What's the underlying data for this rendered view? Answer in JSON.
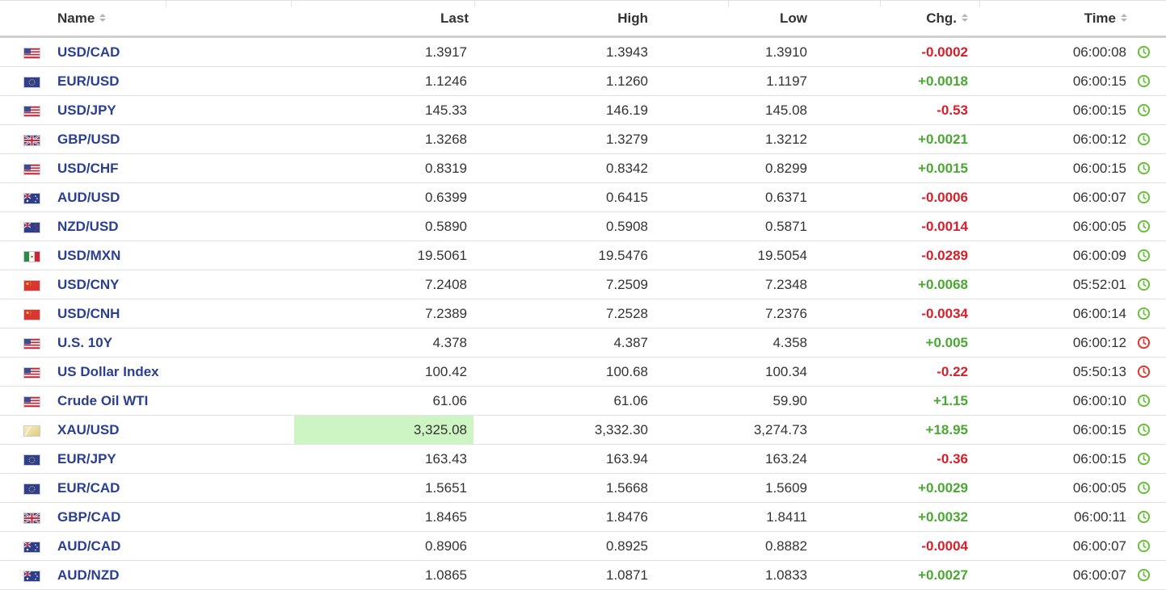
{
  "header": {
    "name_label": "Name",
    "last_label": "Last",
    "high_label": "High",
    "low_label": "Low",
    "chg_label": "Chg.",
    "time_label": "Time"
  },
  "colors": {
    "link": "#2a3f90",
    "positive": "#4aa832",
    "negative": "#d3202a",
    "highlight": "#cdf5c4",
    "clock_green": "#6abf3a",
    "clock_red": "#e5342d"
  },
  "rows": [
    {
      "name": "USD/CAD",
      "flag": "us-flag-icon",
      "last": "1.3917",
      "high": "1.3943",
      "low": "1.3910",
      "chg": "-0.0002",
      "time": "06:00:08",
      "status": "green-clock-icon"
    },
    {
      "name": "EUR/USD",
      "flag": "eu-flag-icon",
      "last": "1.1246",
      "high": "1.1260",
      "low": "1.1197",
      "chg": "+0.0018",
      "time": "06:00:15",
      "status": "green-clock-icon"
    },
    {
      "name": "USD/JPY",
      "flag": "us-flag-icon",
      "last": "145.33",
      "high": "146.19",
      "low": "145.08",
      "chg": "-0.53",
      "time": "06:00:15",
      "status": "green-clock-icon"
    },
    {
      "name": "GBP/USD",
      "flag": "uk-flag-icon",
      "last": "1.3268",
      "high": "1.3279",
      "low": "1.3212",
      "chg": "+0.0021",
      "time": "06:00:12",
      "status": "green-clock-icon"
    },
    {
      "name": "USD/CHF",
      "flag": "us-flag-icon",
      "last": "0.8319",
      "high": "0.8342",
      "low": "0.8299",
      "chg": "+0.0015",
      "time": "06:00:15",
      "status": "green-clock-icon"
    },
    {
      "name": "AUD/USD",
      "flag": "au-flag-icon",
      "last": "0.6399",
      "high": "0.6415",
      "low": "0.6371",
      "chg": "-0.0006",
      "time": "06:00:07",
      "status": "green-clock-icon"
    },
    {
      "name": "NZD/USD",
      "flag": "nz-flag-icon",
      "last": "0.5890",
      "high": "0.5908",
      "low": "0.5871",
      "chg": "-0.0014",
      "time": "06:00:05",
      "status": "green-clock-icon"
    },
    {
      "name": "USD/MXN",
      "flag": "mx-flag-icon",
      "last": "19.5061",
      "high": "19.5476",
      "low": "19.5054",
      "chg": "-0.0289",
      "time": "06:00:09",
      "status": "green-clock-icon"
    },
    {
      "name": "USD/CNY",
      "flag": "cn-flag-icon",
      "last": "7.2408",
      "high": "7.2509",
      "low": "7.2348",
      "chg": "+0.0068",
      "time": "05:52:01",
      "status": "green-clock-icon"
    },
    {
      "name": "USD/CNH",
      "flag": "cn-flag-icon",
      "last": "7.2389",
      "high": "7.2528",
      "low": "7.2376",
      "chg": "-0.0034",
      "time": "06:00:14",
      "status": "green-clock-icon"
    },
    {
      "name": "U.S. 10Y",
      "flag": "us-flag-icon",
      "last": "4.378",
      "high": "4.387",
      "low": "4.358",
      "chg": "+0.005",
      "time": "06:00:12",
      "status": "red-clock-icon"
    },
    {
      "name": "US Dollar Index",
      "flag": "us-flag-icon",
      "last": "100.42",
      "high": "100.68",
      "low": "100.34",
      "chg": "-0.22",
      "time": "05:50:13",
      "status": "red-clock-icon"
    },
    {
      "name": "Crude Oil WTI",
      "flag": "us-flag-icon",
      "last": "61.06",
      "high": "61.06",
      "low": "59.90",
      "chg": "+1.15",
      "time": "06:00:10",
      "status": "green-clock-icon"
    },
    {
      "name": "XAU/USD",
      "flag": "gold-icon",
      "last": "3,325.08",
      "high": "3,332.30",
      "low": "3,274.73",
      "chg": "+18.95",
      "time": "06:00:15",
      "status": "green-clock-icon",
      "last_highlight": true
    },
    {
      "name": "EUR/JPY",
      "flag": "eu-flag-icon",
      "last": "163.43",
      "high": "163.94",
      "low": "163.24",
      "chg": "-0.36",
      "time": "06:00:15",
      "status": "green-clock-icon"
    },
    {
      "name": "EUR/CAD",
      "flag": "eu-flag-icon",
      "last": "1.5651",
      "high": "1.5668",
      "low": "1.5609",
      "chg": "+0.0029",
      "time": "06:00:05",
      "status": "green-clock-icon"
    },
    {
      "name": "GBP/CAD",
      "flag": "uk-flag-icon",
      "last": "1.8465",
      "high": "1.8476",
      "low": "1.8411",
      "chg": "+0.0032",
      "time": "06:00:11",
      "status": "green-clock-icon"
    },
    {
      "name": "AUD/CAD",
      "flag": "au-flag-icon",
      "last": "0.8906",
      "high": "0.8925",
      "low": "0.8882",
      "chg": "-0.0004",
      "time": "06:00:07",
      "status": "green-clock-icon"
    },
    {
      "name": "AUD/NZD",
      "flag": "au-flag-icon",
      "last": "1.0865",
      "high": "1.0871",
      "low": "1.0833",
      "chg": "+0.0027",
      "time": "06:00:07",
      "status": "green-clock-icon"
    }
  ]
}
